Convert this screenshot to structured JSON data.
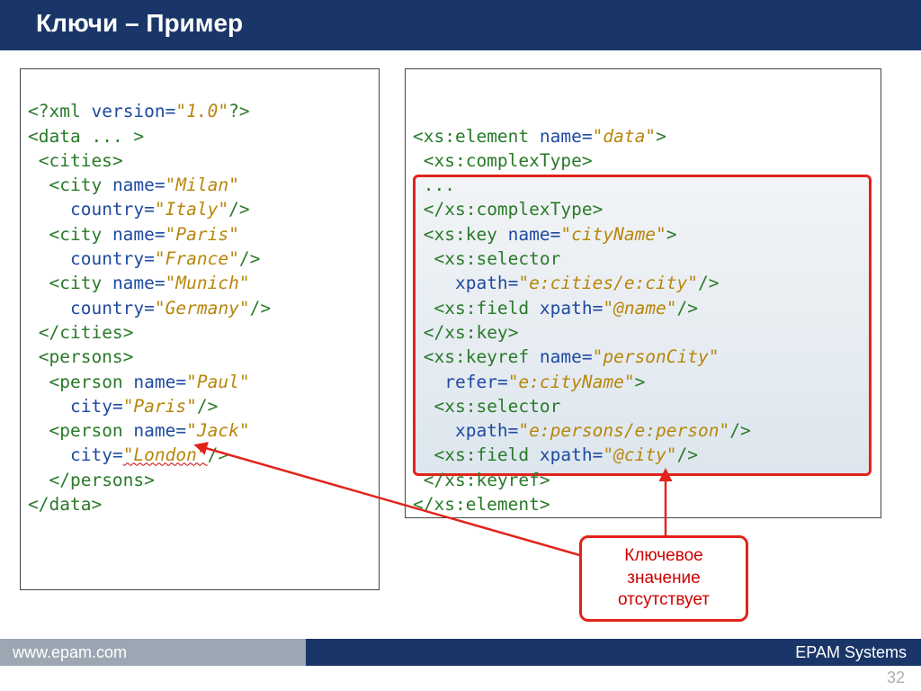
{
  "header": {
    "title": "Ключи – Пример"
  },
  "left_code": {
    "l1a": "<?",
    "l1b": "xml",
    "l1c": "version",
    "l1d": "=",
    "l1e": "\"1.0\"",
    "l1f": "?>",
    "l2a": "<",
    "l2b": "data",
    "l2c": " ... ",
    "l2d": ">",
    "l3a": " <",
    "l3b": "cities",
    "l3c": ">",
    "l4a": "  <",
    "l4b": "city",
    "l4c": " name",
    "l4d": "=",
    "l4e": "\"Milan\"",
    "l5a": "    ",
    "l5b": "country",
    "l5c": "=",
    "l5d": "\"Italy\"",
    "l5e": "/>",
    "l6a": "  <",
    "l6b": "city",
    "l6c": " name",
    "l6d": "=",
    "l6e": "\"Paris\"",
    "l7a": "    ",
    "l7b": "country",
    "l7c": "=",
    "l7d": "\"France\"",
    "l7e": "/>",
    "l8a": "  <",
    "l8b": "city",
    "l8c": " name",
    "l8d": "=",
    "l8e": "\"Munich\"",
    "l9a": "    ",
    "l9b": "country",
    "l9c": "=",
    "l9d": "\"Germany\"",
    "l9e": "/>",
    "l10a": " </",
    "l10b": "cities",
    "l10c": ">",
    "l11a": " <",
    "l11b": "persons",
    "l11c": ">",
    "l12a": "  <",
    "l12b": "person",
    "l12c": " name",
    "l12d": "=",
    "l12e": "\"Paul\"",
    "l13a": "    ",
    "l13b": "city",
    "l13c": "=",
    "l13d": "\"Paris\"",
    "l13e": "/>",
    "l14a": "  <",
    "l14b": "person",
    "l14c": " name",
    "l14d": "=",
    "l14e": "\"Jack\"",
    "l15a": "    ",
    "l15b": "city",
    "l15c": "=",
    "l15d": "\"London\"",
    "l15e": "/>",
    "l16a": "  </",
    "l16b": "persons",
    "l16c": ">",
    "l17a": "</",
    "l17b": "data",
    "l17c": ">"
  },
  "right_code": {
    "r1a": "<",
    "r1b": "xs:element",
    "r1c": " name",
    "r1d": "=",
    "r1e": "\"data\"",
    "r1f": ">",
    "r2a": " <",
    "r2b": "xs:complexType",
    "r2c": ">",
    "r3": " ...",
    "r4a": " </",
    "r4b": "xs:complexType",
    "r4c": ">",
    "r5a": " <",
    "r5b": "xs:key",
    "r5c": " name",
    "r5d": "=",
    "r5e": "\"cityName\"",
    "r5f": ">",
    "r6a": "  <",
    "r6b": "xs:selector",
    "r7a": "    ",
    "r7b": "xpath",
    "r7c": "=",
    "r7d": "\"e:cities/e:city\"",
    "r7e": "/>",
    "r8a": "  <",
    "r8b": "xs:field",
    "r8c": " xpath",
    "r8d": "=",
    "r8e": "\"@name\"",
    "r8f": "/>",
    "r9a": " </",
    "r9b": "xs:key",
    "r9c": ">",
    "r10a": " <",
    "r10b": "xs:keyref",
    "r10c": " name",
    "r10d": "=",
    "r10e": "\"personCity\"",
    "r11a": "   ",
    "r11b": "refer",
    "r11c": "=",
    "r11d": "\"e:cityName\"",
    "r11e": ">",
    "r12a": "  <",
    "r12b": "xs:selector",
    "r13a": "    ",
    "r13b": "xpath",
    "r13c": "=",
    "r13d": "\"e:persons/e:person\"",
    "r13e": "/>",
    "r14a": "  <",
    "r14b": "xs:field",
    "r14c": " xpath",
    "r14d": "=",
    "r14e": "\"@city\"",
    "r14f": "/>",
    "r15a": " </",
    "r15b": "xs:keyref",
    "r15c": ">",
    "r16a": "</",
    "r16b": "xs:element",
    "r16c": ">"
  },
  "callout": {
    "line1": "Ключевое",
    "line2": "значение",
    "line3": "отсутствует"
  },
  "footer": {
    "left": "www.epam.com",
    "right": "EPAM Systems",
    "page": "32"
  }
}
